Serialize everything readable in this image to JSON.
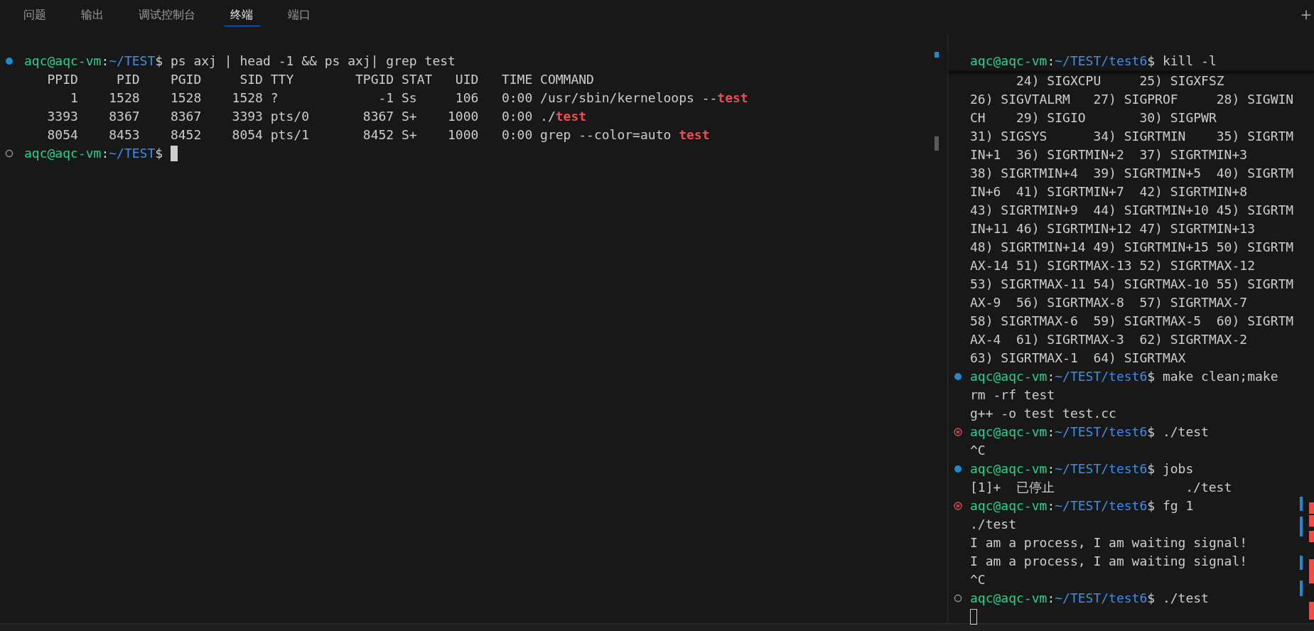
{
  "tabs": [
    {
      "label": "问题",
      "selected": false
    },
    {
      "label": "输出",
      "selected": false
    },
    {
      "label": "调试控制台",
      "selected": false
    },
    {
      "label": "终端",
      "selected": true
    },
    {
      "label": "端口",
      "selected": false
    }
  ],
  "terminals": [
    {
      "sticky_header": false,
      "lines": [
        {
          "kind": "prompt",
          "badge": {
            "kind": "success"
          },
          "user": "aqc@aqc-vm",
          "separator": ":",
          "path": "~/TEST",
          "command": "$ ps axj | head -1 && ps axj| grep test"
        },
        {
          "kind": "output",
          "spans": [
            {
              "text": "   PPID     PID    PGID     SID TTY        TPGID STAT   UID   TIME COMMAND",
              "match": false
            }
          ]
        },
        {
          "kind": "output",
          "spans": [
            {
              "text": "      1    1528    1528    1528 ?             -1 Ss     106   0:00 /usr/sbin/kerneloops --",
              "match": false
            },
            {
              "text": "test",
              "match": true
            }
          ]
        },
        {
          "kind": "output",
          "spans": [
            {
              "text": "   3393    8367    8367    3393 pts/0       8367 S+    1000   0:00 ./",
              "match": false
            },
            {
              "text": "test",
              "match": true
            }
          ]
        },
        {
          "kind": "output",
          "spans": [
            {
              "text": "   8054    8453    8452    8054 pts/1       8452 S+    1000   0:00 grep --color=auto ",
              "match": false
            },
            {
              "text": "test",
              "match": true
            }
          ]
        },
        {
          "kind": "prompt",
          "badge": {
            "kind": "pending"
          },
          "user": "aqc@aqc-vm",
          "separator": ":",
          "path": "~/TEST",
          "command": "$ ",
          "cursor_focused": true
        }
      ]
    },
    {
      "sticky_header": true,
      "lines": [
        {
          "kind": "prompt",
          "user": "aqc@aqc-vm",
          "separator": ":",
          "path": "~/TEST/test6",
          "command": "$ kill -l"
        },
        {
          "kind": "output",
          "spans": [
            {
              "text": "      24) SIGXCPU     25) SIGXFSZ",
              "match": false
            }
          ]
        },
        {
          "kind": "output",
          "spans": [
            {
              "text": "26) SIGVTALRM   27) SIGPROF     28) SIGWIN",
              "match": false
            }
          ]
        },
        {
          "kind": "output",
          "spans": [
            {
              "text": "CH    29) SIGIO       30) SIGPWR",
              "match": false
            }
          ]
        },
        {
          "kind": "output",
          "spans": [
            {
              "text": "31) SIGSYS      34) SIGRTMIN    35) SIGRTM",
              "match": false
            }
          ]
        },
        {
          "kind": "output",
          "spans": [
            {
              "text": "IN+1  36) SIGRTMIN+2  37) SIGRTMIN+3",
              "match": false
            }
          ]
        },
        {
          "kind": "output",
          "spans": [
            {
              "text": "38) SIGRTMIN+4  39) SIGRTMIN+5  40) SIGRTM",
              "match": false
            }
          ]
        },
        {
          "kind": "output",
          "spans": [
            {
              "text": "IN+6  41) SIGRTMIN+7  42) SIGRTMIN+8",
              "match": false
            }
          ]
        },
        {
          "kind": "output",
          "spans": [
            {
              "text": "43) SIGRTMIN+9  44) SIGRTMIN+10 45) SIGRTM",
              "match": false
            }
          ]
        },
        {
          "kind": "output",
          "spans": [
            {
              "text": "IN+11 46) SIGRTMIN+12 47) SIGRTMIN+13",
              "match": false
            }
          ]
        },
        {
          "kind": "output",
          "spans": [
            {
              "text": "48) SIGRTMIN+14 49) SIGRTMIN+15 50) SIGRTM",
              "match": false
            }
          ]
        },
        {
          "kind": "output",
          "spans": [
            {
              "text": "AX-14 51) SIGRTMAX-13 52) SIGRTMAX-12",
              "match": false
            }
          ]
        },
        {
          "kind": "output",
          "spans": [
            {
              "text": "53) SIGRTMAX-11 54) SIGRTMAX-10 55) SIGRTM",
              "match": false
            }
          ]
        },
        {
          "kind": "output",
          "spans": [
            {
              "text": "AX-9  56) SIGRTMAX-8  57) SIGRTMAX-7",
              "match": false
            }
          ]
        },
        {
          "kind": "output",
          "spans": [
            {
              "text": "58) SIGRTMAX-6  59) SIGRTMAX-5  60) SIGRTM",
              "match": false
            }
          ]
        },
        {
          "kind": "output",
          "spans": [
            {
              "text": "AX-4  61) SIGRTMAX-3  62) SIGRTMAX-2",
              "match": false
            }
          ]
        },
        {
          "kind": "output",
          "spans": [
            {
              "text": "63) SIGRTMAX-1  64) SIGRTMAX",
              "match": false
            }
          ]
        },
        {
          "kind": "prompt",
          "badge": {
            "kind": "success"
          },
          "user": "aqc@aqc-vm",
          "separator": ":",
          "path": "~/TEST/test6",
          "command": "$ make clean;make"
        },
        {
          "kind": "output",
          "spans": [
            {
              "text": "rm -rf test",
              "match": false
            }
          ]
        },
        {
          "kind": "output",
          "spans": [
            {
              "text": "g++ -o test test.cc",
              "match": false
            }
          ]
        },
        {
          "kind": "prompt",
          "badge": {
            "kind": "error"
          },
          "user": "aqc@aqc-vm",
          "separator": ":",
          "path": "~/TEST/test6",
          "command": "$ ./test"
        },
        {
          "kind": "output",
          "spans": [
            {
              "text": "^C",
              "match": false
            }
          ]
        },
        {
          "kind": "prompt",
          "badge": {
            "kind": "success"
          },
          "user": "aqc@aqc-vm",
          "separator": ":",
          "path": "~/TEST/test6",
          "command": "$ jobs"
        },
        {
          "kind": "output",
          "spans": [
            {
              "text": "[1]+  已停止                 ./test",
              "match": false
            }
          ]
        },
        {
          "kind": "prompt",
          "badge": {
            "kind": "error"
          },
          "user": "aqc@aqc-vm",
          "separator": ":",
          "path": "~/TEST/test6",
          "command": "$ fg 1"
        },
        {
          "kind": "output",
          "spans": [
            {
              "text": "./test",
              "match": false
            }
          ]
        },
        {
          "kind": "output",
          "spans": [
            {
              "text": "I am a process, I am waiting signal!",
              "match": false
            }
          ]
        },
        {
          "kind": "output",
          "spans": [
            {
              "text": "I am a process, I am waiting signal!",
              "match": false
            }
          ]
        },
        {
          "kind": "output",
          "spans": [
            {
              "text": "^C",
              "match": false
            }
          ]
        },
        {
          "kind": "prompt",
          "badge": {
            "kind": "pending"
          },
          "user": "aqc@aqc-vm",
          "separator": ":",
          "path": "~/TEST/test6",
          "command": "$ ./test"
        },
        {
          "kind": "cursor",
          "focused": false
        }
      ]
    }
  ]
}
